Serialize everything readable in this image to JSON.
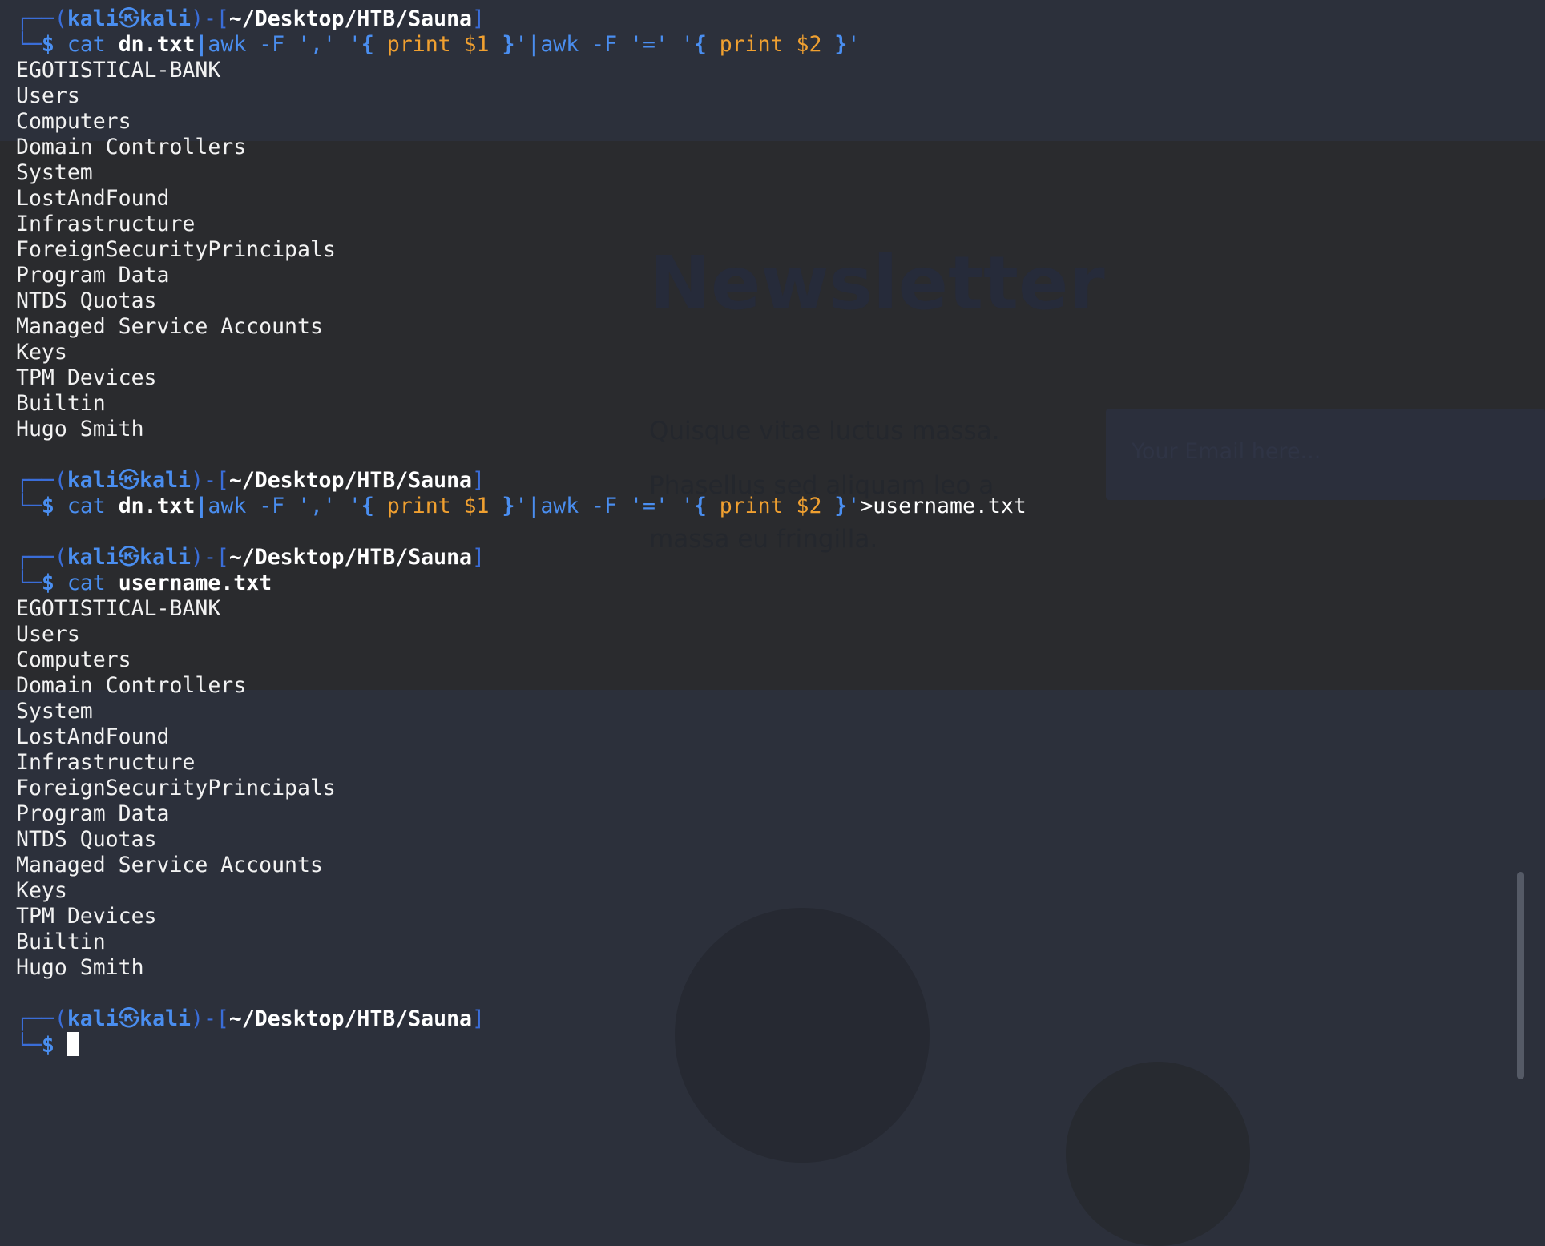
{
  "background_page": {
    "title": "Newsletter",
    "text1": "Quisque vitae luctus massa.",
    "text2": "Phasellus sed aliquam leo a",
    "text3": "massa eu fringilla.",
    "email_placeholder": "Your Email here..."
  },
  "prompt": {
    "open": "┌──(",
    "user": "kali",
    "skull": "㉿",
    "host": "kali",
    "mid": ")-[",
    "path": "~/Desktop/HTB/Sauna",
    "close": "]",
    "corner": "└─",
    "dollar": "$"
  },
  "cmd1": {
    "cat": "cat",
    "file": "dn.txt",
    "pipe": "|",
    "awk1": "awk -F ','",
    "q1": "'",
    "brace_open": "{",
    "print1": "print $1",
    "brace_close": "}",
    "awk2": "awk -F '='",
    "print2": "print $2",
    "redirect": ">username.txt"
  },
  "cmd3": {
    "cat": "cat",
    "file": "username.txt"
  },
  "output": [
    "EGOTISTICAL-BANK",
    "Users",
    "Computers",
    "Domain Controllers",
    "System",
    "LostAndFound",
    "Infrastructure",
    "ForeignSecurityPrincipals",
    "Program Data",
    "NTDS Quotas",
    "Managed Service Accounts",
    "Keys",
    "TPM Devices",
    "Builtin",
    "Hugo Smith"
  ]
}
